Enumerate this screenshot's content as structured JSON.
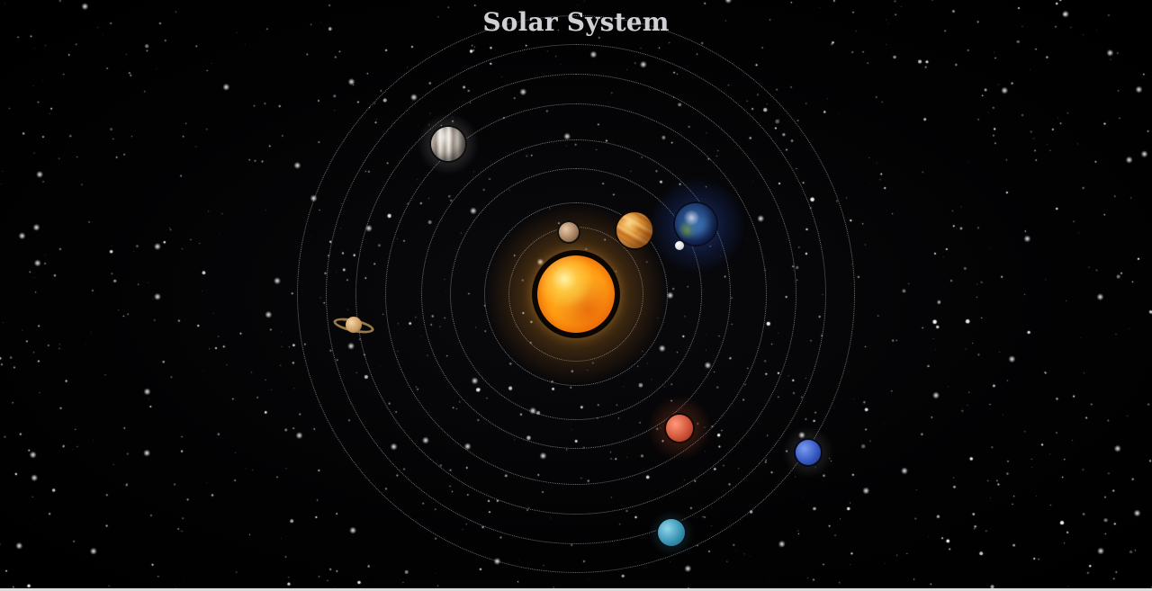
{
  "page": {
    "title": "Solar System"
  },
  "scene": {
    "planets": [
      {
        "id": "mercury",
        "icon": "mercury-icon"
      },
      {
        "id": "venus",
        "icon": "venus-icon"
      },
      {
        "id": "earth",
        "icon": "earth-icon"
      },
      {
        "id": "moon",
        "icon": "moon-icon"
      },
      {
        "id": "mars",
        "icon": "mars-icon"
      },
      {
        "id": "jupiter",
        "icon": "jupiter-icon"
      },
      {
        "id": "saturn",
        "icon": "saturn-icon"
      },
      {
        "id": "uranus",
        "icon": "uranus-icon"
      },
      {
        "id": "neptune",
        "icon": "neptune-icon"
      }
    ],
    "colors": {
      "background": "#000000",
      "title": "#cfcfd4",
      "orbit": "#d2d2d2",
      "sun": "#ff9a12"
    }
  }
}
